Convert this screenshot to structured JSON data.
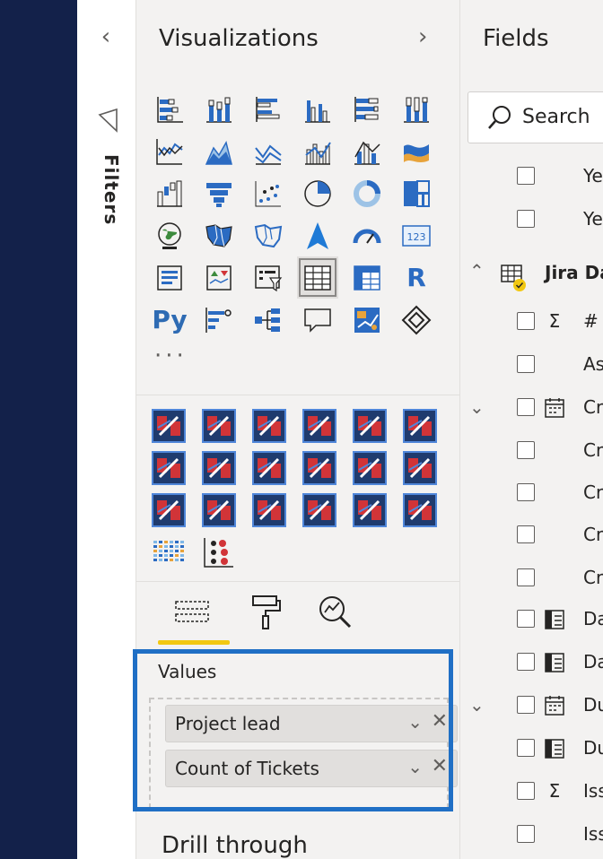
{
  "filters": {
    "label": "Filters",
    "collapse_icon": "chevron-left-icon",
    "funnel_icon": "funnel-icon"
  },
  "visualizations": {
    "title": "Visualizations",
    "expand_icon": "chevron-right-icon",
    "more": "···",
    "icons": [
      "stacked-bar-icon",
      "stacked-column-icon",
      "clustered-bar-icon",
      "clustered-column-icon",
      "100pct-bar-icon",
      "100pct-column-icon",
      "line-chart-icon",
      "area-chart-icon",
      "stacked-area-icon",
      "line-column-icon",
      "line-clustered-column-icon",
      "ribbon-chart-icon",
      "waterfall-icon",
      "funnel-chart-icon",
      "scatter-icon",
      "pie-chart-icon",
      "donut-chart-icon",
      "treemap-icon",
      "map-icon",
      "filled-map-icon",
      "shape-map-icon",
      "azure-map-icon",
      "gauge-icon",
      "card-icon",
      "multi-row-card-icon",
      "kpi-icon",
      "slicer-icon",
      "table-icon",
      "matrix-icon",
      "r-visual-icon",
      "python-visual-icon",
      "key-influencers-icon",
      "decomposition-tree-icon",
      "qa-icon",
      "smart-narrative-icon",
      "paginated-report-icon"
    ],
    "python_label": "Py",
    "r_label": "R",
    "custom_icon_count_note": "",
    "custom_icons": [
      "custom-visual-icon",
      "custom-visual-icon",
      "custom-visual-icon",
      "custom-visual-icon",
      "custom-visual-icon",
      "custom-visual-icon",
      "custom-visual-icon",
      "custom-visual-icon",
      "custom-visual-icon",
      "custom-visual-icon",
      "custom-visual-icon",
      "custom-visual-icon",
      "custom-visual-icon",
      "custom-visual-icon",
      "custom-visual-icon",
      "custom-visual-icon",
      "custom-visual-icon",
      "custom-visual-icon",
      "heatmap-custom-icon",
      "dot-custom-icon"
    ]
  },
  "tabs": {
    "fields_tab_icon": "fields-well-icon",
    "format_tab_icon": "paint-roller-icon",
    "analytics_tab_icon": "analytics-magnifier-icon"
  },
  "values": {
    "label": "Values",
    "items": [
      {
        "label": "Project lead"
      },
      {
        "label": "Count of Tickets"
      }
    ]
  },
  "drill_through": {
    "title": "Drill through"
  },
  "fields": {
    "title": "Fields",
    "search_placeholder": "Search",
    "table_name": "Jira Da",
    "rows": [
      {
        "text": "Ye",
        "type": "",
        "chevron": ""
      },
      {
        "text": "Ye",
        "type": "",
        "chevron": ""
      },
      {
        "text": "# (",
        "type": "Σ",
        "chevron": ""
      },
      {
        "text": "As",
        "type": "",
        "chevron": ""
      },
      {
        "text": "Cr",
        "type": "calendar",
        "chevron": "expand"
      },
      {
        "text": "Cr",
        "type": "",
        "chevron": ""
      },
      {
        "text": "Cr",
        "type": "",
        "chevron": ""
      },
      {
        "text": "Cr",
        "type": "",
        "chevron": ""
      },
      {
        "text": "Cr",
        "type": "",
        "chevron": ""
      },
      {
        "text": "Da",
        "type": "hierarchy",
        "chevron": ""
      },
      {
        "text": "Da",
        "type": "hierarchy",
        "chevron": ""
      },
      {
        "text": "Du",
        "type": "calendar",
        "chevron": "expand"
      },
      {
        "text": "Du",
        "type": "hierarchy",
        "chevron": ""
      },
      {
        "text": "Iss",
        "type": "Σ",
        "chevron": ""
      },
      {
        "text": "Iss",
        "type": "",
        "chevron": ""
      }
    ]
  },
  "colors": {
    "navy": "#13214a",
    "highlight": "#1f6fc5",
    "accent_yellow": "#f2c811",
    "icon_blue": "#2b6bc2"
  }
}
